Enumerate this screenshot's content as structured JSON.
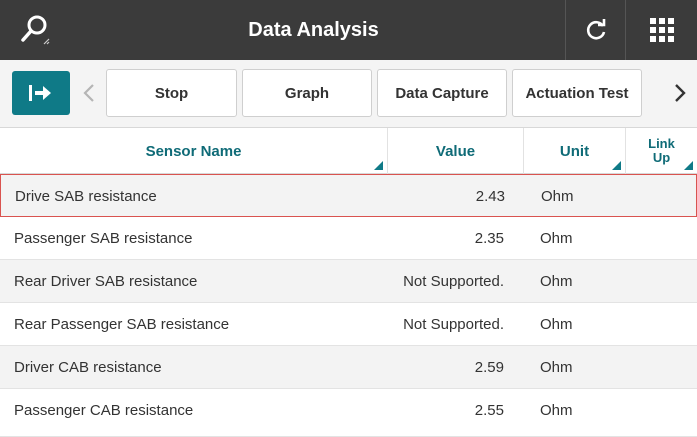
{
  "header": {
    "title": "Data Analysis",
    "search_icon": "search-icon",
    "refresh_icon": "refresh-icon",
    "grid_icon": "grid-menu-icon"
  },
  "toolbar": {
    "exit_icon": "exit-arrow-icon",
    "buttons": [
      "Stop",
      "Graph",
      "Data Capture",
      "Actuation Test"
    ]
  },
  "table": {
    "columns": {
      "name": "Sensor Name",
      "value": "Value",
      "unit": "Unit",
      "link": "Link Up"
    },
    "rows": [
      {
        "name": "Drive SAB resistance",
        "value": "2.43",
        "unit": "Ohm"
      },
      {
        "name": "Passenger SAB resistance",
        "value": "2.35",
        "unit": "Ohm"
      },
      {
        "name": "Rear Driver SAB resistance",
        "value": "Not Supported.",
        "unit": "Ohm"
      },
      {
        "name": "Rear Passenger SAB resistance",
        "value": "Not Supported.",
        "unit": "Ohm"
      },
      {
        "name": "Driver CAB resistance",
        "value": "2.59",
        "unit": "Ohm"
      },
      {
        "name": "Passenger CAB resistance",
        "value": "2.55",
        "unit": "Ohm"
      }
    ]
  },
  "colors": {
    "header_bg": "#3b3b3b",
    "accent": "#0f7a87",
    "selection": "#d9534f"
  }
}
